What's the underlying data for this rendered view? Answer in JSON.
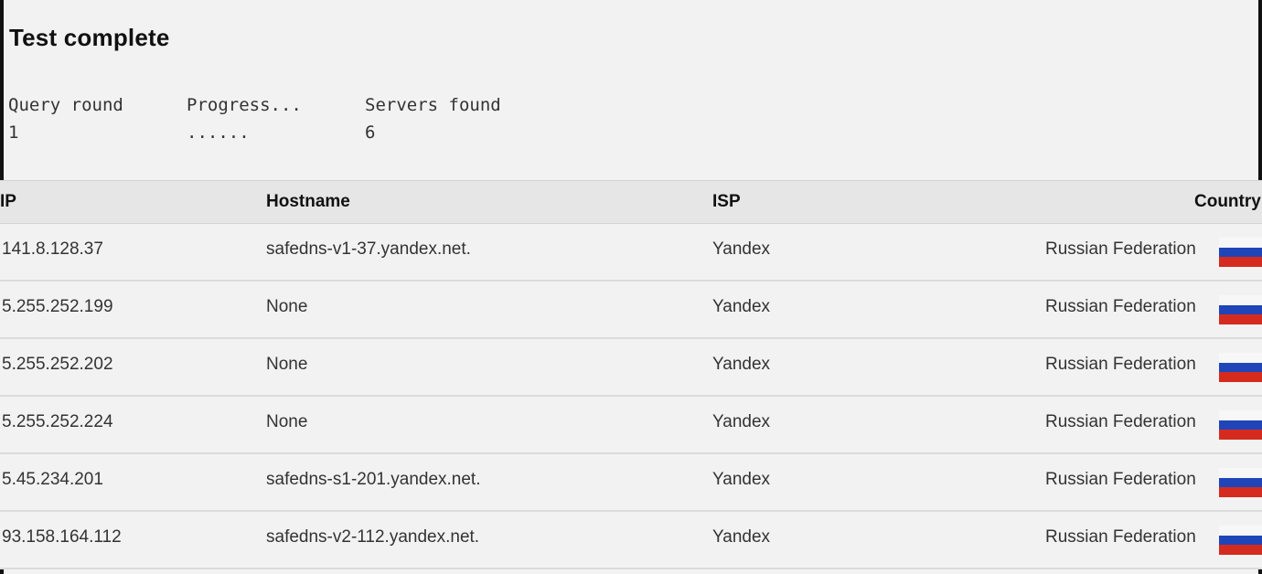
{
  "page": {
    "title": "Test complete"
  },
  "stats": {
    "query_round_label": "Query round",
    "query_round_value": "1",
    "progress_label": "Progress...",
    "progress_value": "......",
    "servers_found_label": "Servers found",
    "servers_found_value": "6"
  },
  "table": {
    "headers": {
      "ip": "IP",
      "hostname": "Hostname",
      "isp": "ISP",
      "country": "Country"
    },
    "rows": [
      {
        "ip": "141.8.128.37",
        "hostname": "safedns-v1-37.yandex.net.",
        "isp": "Yandex",
        "country": "Russian Federation",
        "flag": "russia-flag-icon"
      },
      {
        "ip": "5.255.252.199",
        "hostname": "None",
        "isp": "Yandex",
        "country": "Russian Federation",
        "flag": "russia-flag-icon"
      },
      {
        "ip": "5.255.252.202",
        "hostname": "None",
        "isp": "Yandex",
        "country": "Russian Federation",
        "flag": "russia-flag-icon"
      },
      {
        "ip": "5.255.252.224",
        "hostname": "None",
        "isp": "Yandex",
        "country": "Russian Federation",
        "flag": "russia-flag-icon"
      },
      {
        "ip": "5.45.234.201",
        "hostname": "safedns-s1-201.yandex.net.",
        "isp": "Yandex",
        "country": "Russian Federation",
        "flag": "russia-flag-icon"
      },
      {
        "ip": "93.158.164.112",
        "hostname": "safedns-v2-112.yandex.net.",
        "isp": "Yandex",
        "country": "Russian Federation",
        "flag": "russia-flag-icon"
      }
    ]
  },
  "colors": {
    "background": "#f2f2f2",
    "header_background": "#e6e6e6",
    "flag_white": "#f7f7f7",
    "flag_blue": "#1f45b8",
    "flag_red": "#d52b1e"
  }
}
